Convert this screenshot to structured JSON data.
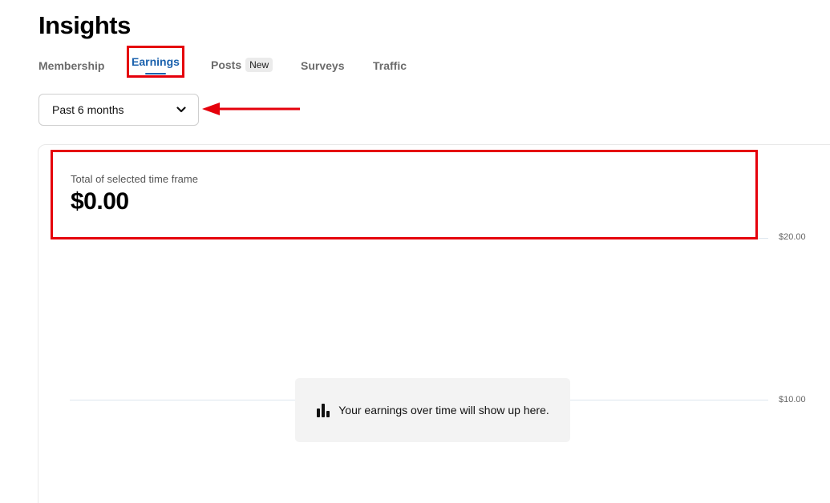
{
  "header": {
    "title": "Insights"
  },
  "tabs": {
    "membership": "Membership",
    "earnings": "Earnings",
    "posts": "Posts",
    "posts_badge": "New",
    "surveys": "Surveys",
    "traffic": "Traffic",
    "active": "Earnings"
  },
  "filter": {
    "selected": "Past 6 months",
    "icon": "chevron-down-icon"
  },
  "earnings": {
    "total_label": "Total of selected time frame",
    "total_value": "$0.00",
    "empty_message": "Your earnings over time will show up here.",
    "empty_icon": "bar-chart-icon"
  },
  "chart_data": {
    "type": "bar",
    "categories": [],
    "values": [],
    "y_ticks": [
      "$20.00",
      "$10.00"
    ],
    "ylim": [
      0,
      20
    ]
  },
  "colors": {
    "accent": "#1a61ad",
    "annotation": "#e5000b",
    "tab_inactive": "#6b6b6b",
    "empty_bg": "#f3f3f3",
    "grid": "#dde6ee"
  }
}
